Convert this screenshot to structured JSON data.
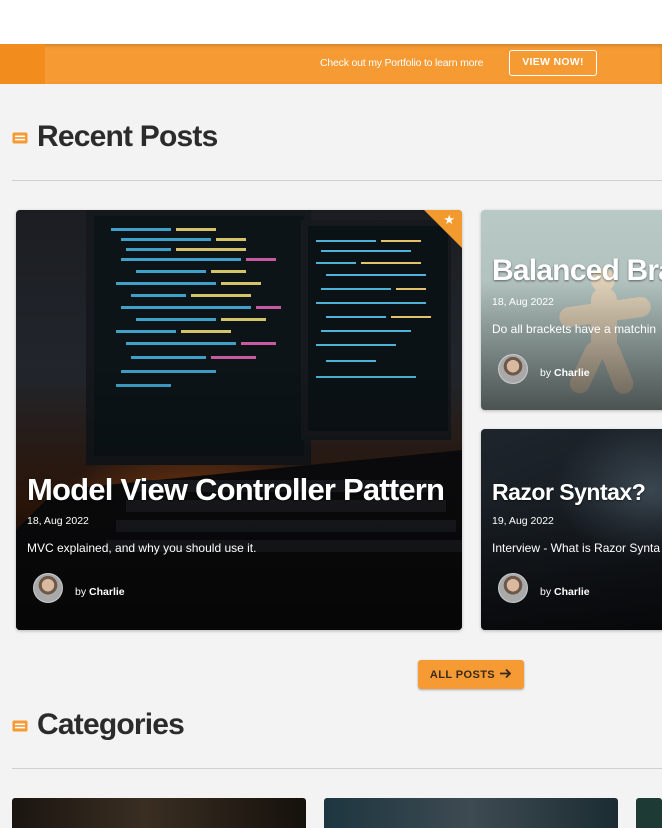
{
  "promo": {
    "text": "Check out my Portfolio to learn more",
    "button": "VIEW NOW!"
  },
  "recent": {
    "heading": "Recent Posts",
    "icon": "card-list-icon"
  },
  "posts": [
    {
      "title": "Model View Controller Pattern",
      "date": "18, Aug 2022",
      "excerpt": "MVC explained, and why you should use it.",
      "by": "by",
      "author": "Charlie",
      "featured_icon": "star-icon"
    },
    {
      "title": "Balanced Bra",
      "date": "18, Aug 2022",
      "excerpt": "Do all brackets have a matchin",
      "by": "by",
      "author": "Charlie"
    },
    {
      "title": "Razor Syntax?",
      "date": "19, Aug 2022",
      "excerpt": "Interview - What is Razor Synta",
      "by": "by",
      "author": "Charlie"
    }
  ],
  "all_posts": {
    "label": "ALL POSTS",
    "icon": "arrow-right-icon"
  },
  "categories": {
    "heading": "Categories",
    "icon": "card-list-icon"
  },
  "colors": {
    "accent": "#f69a33",
    "accent_dark": "#f28c1c",
    "heading_text": "#2b2b2b",
    "background": "#f3f3f3"
  }
}
